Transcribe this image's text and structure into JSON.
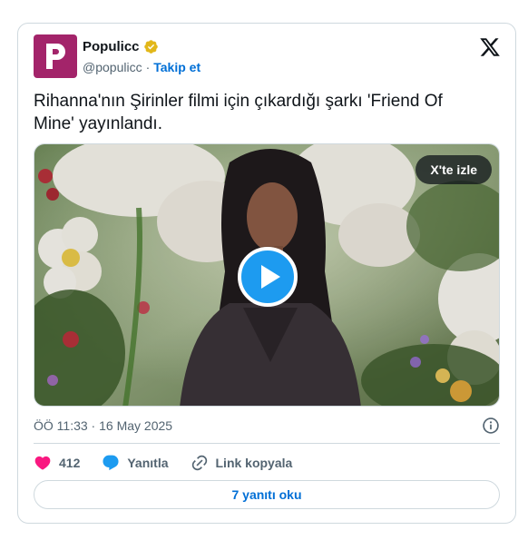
{
  "account": {
    "name": "Populicc",
    "handle": "@populicc",
    "separator": "·",
    "follow_label": "Takip et",
    "avatar_letter": "P",
    "verified_icon": "verified-badge-icon"
  },
  "tweet": {
    "text": "Rihanna'nın Şirinler filmi için çıkardığı şarkı 'Friend Of Mine' yayınlandı.",
    "timestamp": "ÖÖ 11:33 · 16 May 2025"
  },
  "media": {
    "watch_label": "X'te izle",
    "play_icon": "play-icon"
  },
  "actions": {
    "like_count": "412",
    "reply_label": "Yanıtla",
    "copy_link_label": "Link kopyala"
  },
  "footer": {
    "read_replies_label": "7 yanıtı oku"
  },
  "colors": {
    "avatar_bg": "#a3246a",
    "link_blue": "#006fd6",
    "like_pink": "#f91880",
    "reply_blue": "#1d9bf0",
    "play_blue": "#1d9bf0",
    "verified_gold": "#e2b719",
    "border": "#cfd9de",
    "muted_text": "#536471"
  }
}
